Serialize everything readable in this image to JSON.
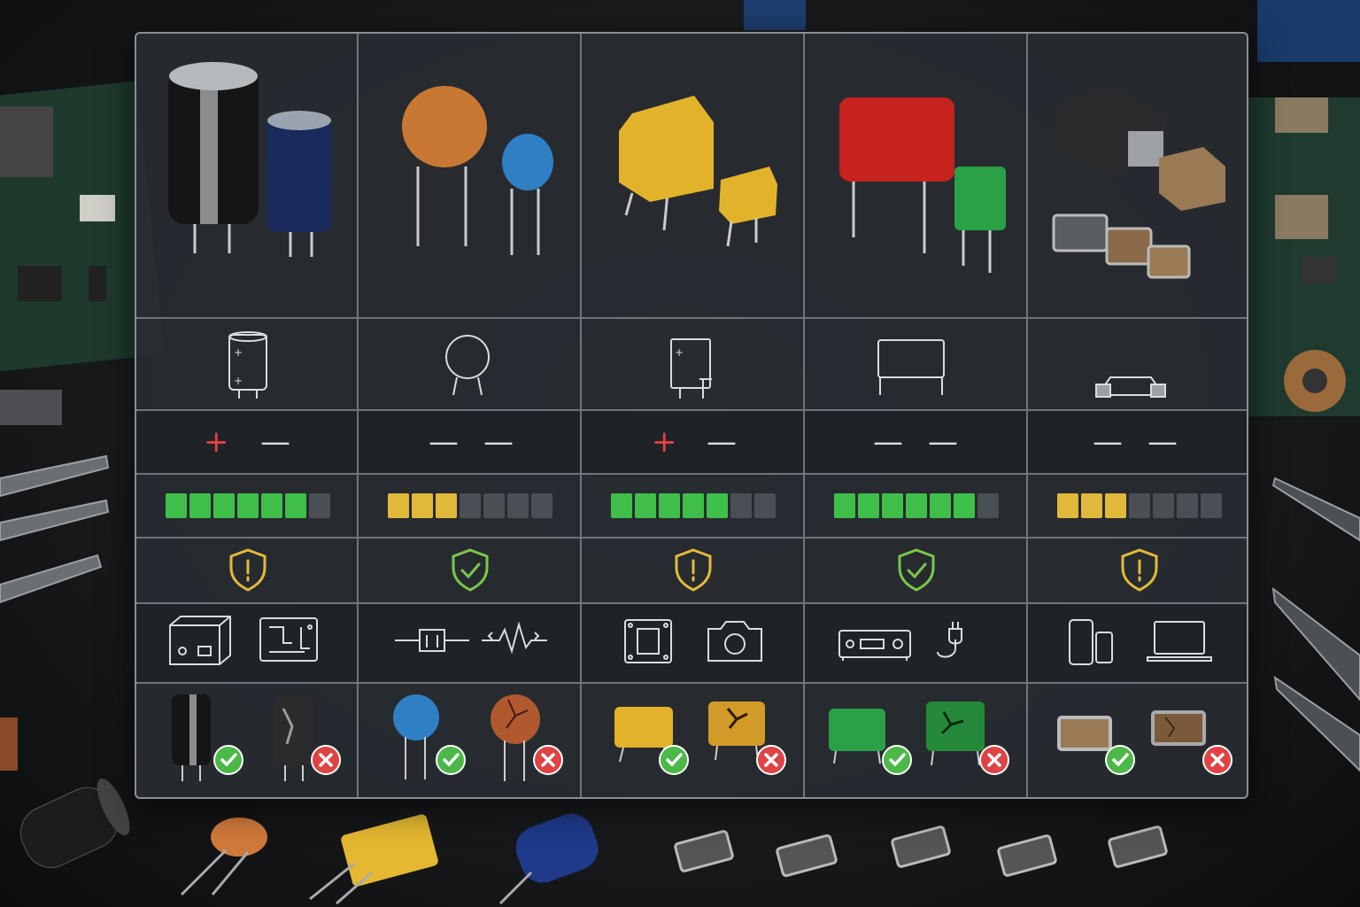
{
  "columns": [
    {
      "id": "electrolytic",
      "polarity": [
        "+",
        "—"
      ],
      "rating_level": 6,
      "rating_max": 7,
      "rating_color": "#3fbf4a",
      "status_icon": "shield-warning-icon",
      "status_color": "#e4b93a",
      "applications": [
        "power-supply-icon",
        "circuit-board-icon"
      ]
    },
    {
      "id": "ceramic-disc",
      "polarity": [
        "—",
        "—"
      ],
      "rating_level": 3,
      "rating_max": 7,
      "rating_color": "#e0b93a",
      "status_icon": "shield-check-icon",
      "status_color": "#7bc64a",
      "applications": [
        "capacitor-symbol-icon",
        "signal-filter-icon"
      ]
    },
    {
      "id": "tantalum",
      "polarity": [
        "+",
        "—"
      ],
      "rating_level": 5,
      "rating_max": 7,
      "rating_color": "#3fbf4a",
      "status_icon": "shield-warning-icon",
      "status_color": "#e4b93a",
      "applications": [
        "chip-module-icon",
        "camera-icon"
      ]
    },
    {
      "id": "film",
      "polarity": [
        "—",
        "—"
      ],
      "rating_level": 6,
      "rating_max": 7,
      "rating_color": "#3fbf4a",
      "status_icon": "shield-check-icon",
      "status_color": "#7bc64a",
      "applications": [
        "audio-receiver-icon",
        "power-plug-icon"
      ]
    },
    {
      "id": "smd-mlcc",
      "polarity": [
        "—",
        "—"
      ],
      "rating_level": 3,
      "rating_max": 7,
      "rating_color": "#e0b93a",
      "status_icon": "shield-warning-icon",
      "status_color": "#e4b93a",
      "applications": [
        "mobile-devices-icon",
        "laptop-icon"
      ]
    }
  ],
  "colors": {
    "good": "#4cb848",
    "bad": "#e04343",
    "plus": "#e04343",
    "minus": "#d9dde0",
    "empty_segment": "#4a4f55"
  }
}
